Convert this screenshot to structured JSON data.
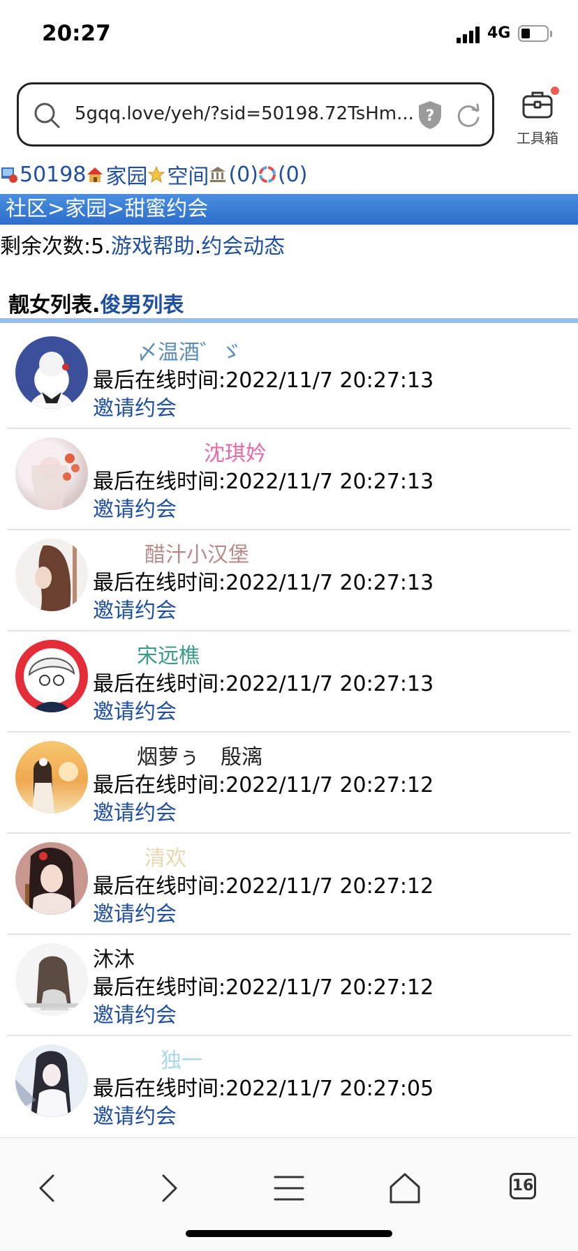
{
  "status_bar": {
    "time": "20:27",
    "network": "4G"
  },
  "address_bar": {
    "url": "5gqq.love/yeh/?sid=50198.72TsHm..."
  },
  "toolbox": {
    "label": "工具箱"
  },
  "nav": {
    "user_id": "50198",
    "home": "家园",
    "space": "空间",
    "bank_count": "(0)",
    "chat_count": "(0)"
  },
  "breadcrumb": "社区>家园>甜蜜约会",
  "info": {
    "remaining": "剩余次数:5.",
    "help": "游戏帮助",
    "sep": ".",
    "activity": "约会动态"
  },
  "tabs": {
    "female": "靓女列表",
    "sep": ".",
    "male": "俊男列表"
  },
  "online_prefix": "最后在线时间:",
  "invite_label": "邀请约会",
  "users": [
    {
      "name": "〆温酒゛ゞ",
      "color": "#5b8fb8",
      "online": "2022/11/7 20:27:13"
    },
    {
      "name": "沈琪妗",
      "color": "#e86aa8",
      "online": "2022/11/7 20:27:13"
    },
    {
      "name": "醋汁小汉堡",
      "color": "#b88a8a",
      "online": "2022/11/7 20:27:13"
    },
    {
      "name": "宋远樵",
      "color": "#3a9a8a",
      "online": "2022/11/7 20:27:13"
    },
    {
      "name": "烟萝ぅ　殷漓",
      "color": "#222222",
      "online": "2022/11/7 20:27:12"
    },
    {
      "name": "清欢",
      "color": "#e8d8b0",
      "online": "2022/11/7 20:27:12"
    },
    {
      "name": "沐沐",
      "color": "#111111",
      "online": "2022/11/7 20:27:12"
    },
    {
      "name": "独一",
      "color": "#a8d8e8",
      "online": "2022/11/7 20:27:05"
    }
  ],
  "bottom_nav": {
    "tab_count": "16"
  }
}
